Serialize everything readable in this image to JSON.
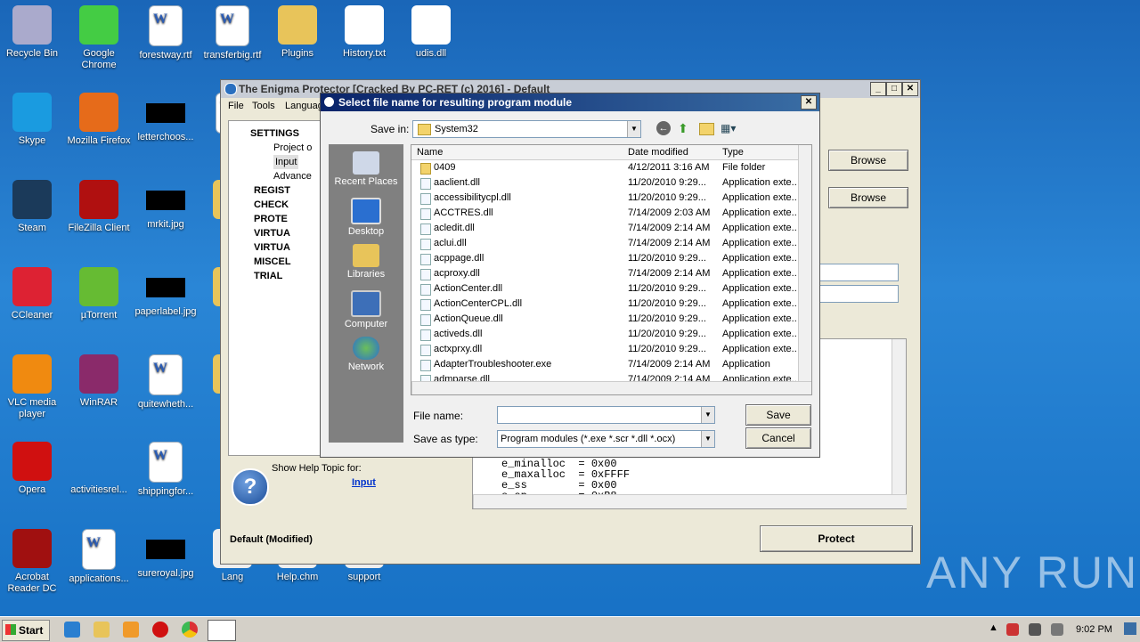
{
  "desktop": {
    "icons": [
      {
        "label": "Recycle Bin"
      },
      {
        "label": "Google Chrome"
      },
      {
        "label": "forestway.rtf"
      },
      {
        "label": "transferbig.rtf"
      },
      {
        "label": "Plugins"
      },
      {
        "label": "History.txt"
      },
      {
        "label": "udis.dll"
      },
      {
        "label": "Skype"
      },
      {
        "label": "Mozilla Firefox"
      },
      {
        "label": "letterchoos..."
      },
      {
        "label": "with"
      },
      {
        "label": "Steam"
      },
      {
        "label": "FileZilla Client"
      },
      {
        "label": "mrkit.jpg"
      },
      {
        "label": "Ema"
      },
      {
        "label": "CCleaner"
      },
      {
        "label": "µTorrent"
      },
      {
        "label": "paperlabel.jpg"
      },
      {
        "label": "Enig"
      },
      {
        "label": "VLC media player"
      },
      {
        "label": "WinRAR"
      },
      {
        "label": "quitewheth..."
      },
      {
        "label": "En"
      },
      {
        "label": "Opera"
      },
      {
        "label": "activitiesrel..."
      },
      {
        "label": "shippingfor..."
      },
      {
        "label": "Acrobat Reader DC"
      },
      {
        "label": "applications..."
      },
      {
        "label": "sureroyal.jpg"
      },
      {
        "label": "Lang"
      },
      {
        "label": "Help.chm"
      },
      {
        "label": "support"
      }
    ]
  },
  "enigma": {
    "title": "The Enigma Protector [Cracked By PC-RET (c) 2016] - Default",
    "menu": [
      "File",
      "Tools",
      "Languag"
    ],
    "tree": [
      {
        "label": "SETTINGS",
        "bold": true
      },
      {
        "label": "Project o"
      },
      {
        "label": "Input"
      },
      {
        "label": "Advance"
      },
      {
        "label": "REGIST",
        "bold": true
      },
      {
        "label": "CHECK",
        "bold": true
      },
      {
        "label": "PROTE",
        "bold": true
      },
      {
        "label": "VIRTUA",
        "bold": true
      },
      {
        "label": "VIRTUA",
        "bold": true
      },
      {
        "label": "MISCEL",
        "bold": true
      },
      {
        "label": "TRIAL",
        "bold": true
      }
    ],
    "browse1": "Browse",
    "browse2": "Browse",
    "help_caption": "Show Help Topic for:",
    "help_link": "Input",
    "status": "Default  (Modified)",
    "protect": "Protect",
    "code_lines": [
      "e_minalloc  = 0x00",
      "e_maxalloc  = 0xFFFF",
      "e_ss        = 0x00",
      "e_sp        = 0xB8"
    ]
  },
  "dialog": {
    "title": "Select file name for resulting program module",
    "save_in_label": "Save in:",
    "save_in_value": "System32",
    "places": [
      "Recent Places",
      "Desktop",
      "Libraries",
      "Computer",
      "Network"
    ],
    "columns": [
      "Name",
      "Date modified",
      "Type"
    ],
    "files": [
      {
        "name": "0409",
        "date": "4/12/2011 3:16 AM",
        "type": "File folder",
        "folder": true
      },
      {
        "name": "aaclient.dll",
        "date": "11/20/2010 9:29...",
        "type": "Application exte..."
      },
      {
        "name": "accessibilitycpl.dll",
        "date": "11/20/2010 9:29...",
        "type": "Application exte..."
      },
      {
        "name": "ACCTRES.dll",
        "date": "7/14/2009 2:03 AM",
        "type": "Application exte..."
      },
      {
        "name": "acledit.dll",
        "date": "7/14/2009 2:14 AM",
        "type": "Application exte..."
      },
      {
        "name": "aclui.dll",
        "date": "7/14/2009 2:14 AM",
        "type": "Application exte..."
      },
      {
        "name": "acppage.dll",
        "date": "11/20/2010 9:29...",
        "type": "Application exte..."
      },
      {
        "name": "acproxy.dll",
        "date": "7/14/2009 2:14 AM",
        "type": "Application exte..."
      },
      {
        "name": "ActionCenter.dll",
        "date": "11/20/2010 9:29...",
        "type": "Application exte..."
      },
      {
        "name": "ActionCenterCPL.dll",
        "date": "11/20/2010 9:29...",
        "type": "Application exte..."
      },
      {
        "name": "ActionQueue.dll",
        "date": "11/20/2010 9:29...",
        "type": "Application exte..."
      },
      {
        "name": "activeds.dll",
        "date": "11/20/2010 9:29...",
        "type": "Application exte..."
      },
      {
        "name": "actxprxy.dll",
        "date": "11/20/2010 9:29...",
        "type": "Application exte..."
      },
      {
        "name": "AdapterTroubleshooter.exe",
        "date": "7/14/2009 2:14 AM",
        "type": "Application"
      },
      {
        "name": "admparse.dll",
        "date": "7/14/2009 2:14 AM",
        "type": "Application exte..."
      }
    ],
    "filename_label": "File name:",
    "filename_value": "",
    "type_label": "Save as type:",
    "type_value": "Program modules (*.exe *.scr *.dll *.ocx)",
    "save": "Save",
    "cancel": "Cancel"
  },
  "taskbar": {
    "start": "Start",
    "clock": "9:02 PM"
  },
  "watermark": "ANY RUN"
}
